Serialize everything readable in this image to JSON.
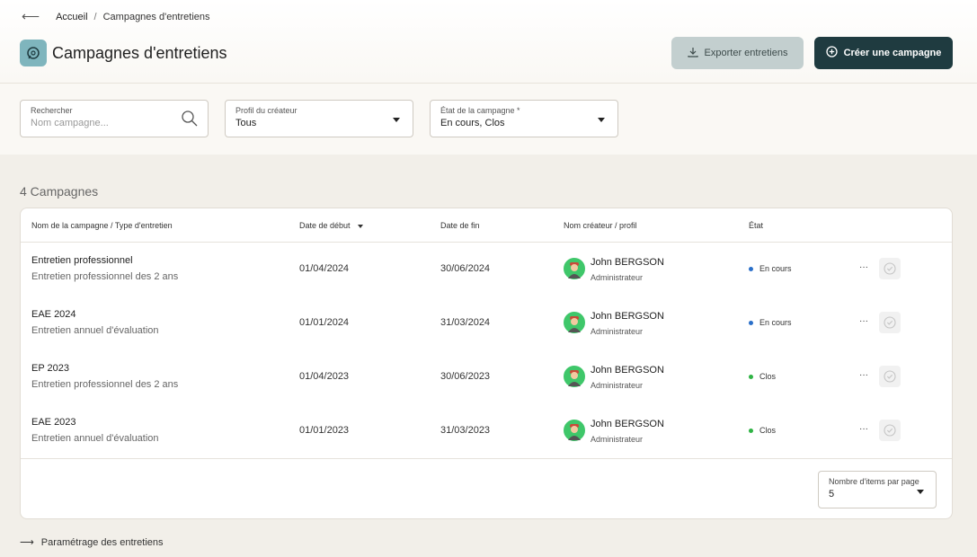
{
  "breadcrumb": {
    "home": "Accueil",
    "separator": "/",
    "current": "Campagnes d'entretiens"
  },
  "header": {
    "title": "Campagnes d'entretiens",
    "export_label": "Exporter entretiens",
    "create_label": "Créer une campagne"
  },
  "filters": {
    "search": {
      "label": "Rechercher",
      "placeholder": "Nom campagne..."
    },
    "creator_profile": {
      "label": "Profil du créateur",
      "value": "Tous"
    },
    "campaign_state": {
      "label": "État de la campagne *",
      "value": "En cours, Clos"
    }
  },
  "list": {
    "count_label": "4 Campagnes",
    "columns": {
      "name": "Nom de la campagne / Type d'entretien",
      "start": "Date de début",
      "end": "Date de fin",
      "creator": "Nom créateur / profil",
      "state": "État"
    },
    "rows": [
      {
        "name": "Entretien professionnel",
        "type": "Entretien professionnel des 2 ans",
        "start": "01/04/2024",
        "end": "30/06/2024",
        "creator": "John BERGSON",
        "role": "Administrateur",
        "state": "En cours",
        "state_color": "#2a6fc9"
      },
      {
        "name": "EAE 2024",
        "type": "Entretien annuel d'évaluation",
        "start": "01/01/2024",
        "end": "31/03/2024",
        "creator": "John BERGSON",
        "role": "Administrateur",
        "state": "En cours",
        "state_color": "#2a6fc9"
      },
      {
        "name": "EP 2023",
        "type": "Entretien professionnel des 2 ans",
        "start": "01/04/2023",
        "end": "30/06/2023",
        "creator": "John BERGSON",
        "role": "Administrateur",
        "state": "Clos",
        "state_color": "#2fb344"
      },
      {
        "name": "EAE 2023",
        "type": "Entretien annuel d'évaluation",
        "start": "01/01/2023",
        "end": "31/03/2023",
        "creator": "John BERGSON",
        "role": "Administrateur",
        "state": "Clos",
        "state_color": "#2fb344"
      }
    ],
    "more_label": "···",
    "per_page": {
      "label": "Nombre d'items par page",
      "value": "5"
    }
  },
  "footer": {
    "settings_link": "Paramétrage des entretiens"
  },
  "icons": {
    "back": "arrow-left-icon",
    "title": "chat-bubble-icon",
    "export": "download-icon",
    "create": "plus-circle-icon",
    "search": "search-icon",
    "row_action": "check-circle-icon",
    "link": "arrow-right-icon"
  },
  "colors": {
    "primary": "#1f3b40",
    "export_button": "#c3cfcf",
    "in_progress": "#2a6fc9",
    "closed": "#2fb344",
    "avatar": "#3fc76a"
  }
}
